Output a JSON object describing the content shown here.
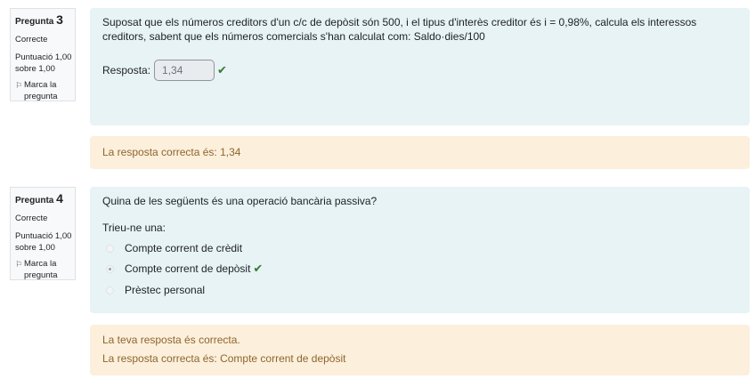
{
  "questions": [
    {
      "label": "Pregunta",
      "number": "3",
      "state": "Correcte",
      "grade": "Puntuació 1,00 sobre 1,00",
      "flag_label": "Marca la pregunta",
      "text": "Suposat que els números creditors d'un c/c de depòsit són 500, i el tipus d'interès creditor és  i = 0,98%, calcula els interessos creditors, sabent que els números comercials s'han calculat com: Saldo·dies/100",
      "answer_label": "Resposta:",
      "answer_value": "1,34",
      "feedback": [
        "La resposta correcta és: 1,34"
      ]
    },
    {
      "label": "Pregunta",
      "number": "4",
      "state": "Correcte",
      "grade": "Puntuació 1,00 sobre 1,00",
      "flag_label": "Marca la pregunta",
      "text": "Quina de les següents és una operació bancària passiva?",
      "prompt": "Trieu-ne una:",
      "options": [
        {
          "label": "Compte corrent de crèdit",
          "selected": false
        },
        {
          "label": "Compte corrent de depòsit",
          "selected": true
        },
        {
          "label": "Prèstec personal",
          "selected": false
        }
      ],
      "feedback": [
        "La teva resposta és correcta.",
        "La resposta correcta és: Compte corrent de depòsit"
      ]
    }
  ],
  "icons": {
    "flag": "flag-icon",
    "correct": "check-icon"
  },
  "colors": {
    "content_bg": "#e7f3f5",
    "feedback_bg": "#fcefdc",
    "feedback_text": "#8e662e",
    "check": "#357a32"
  }
}
